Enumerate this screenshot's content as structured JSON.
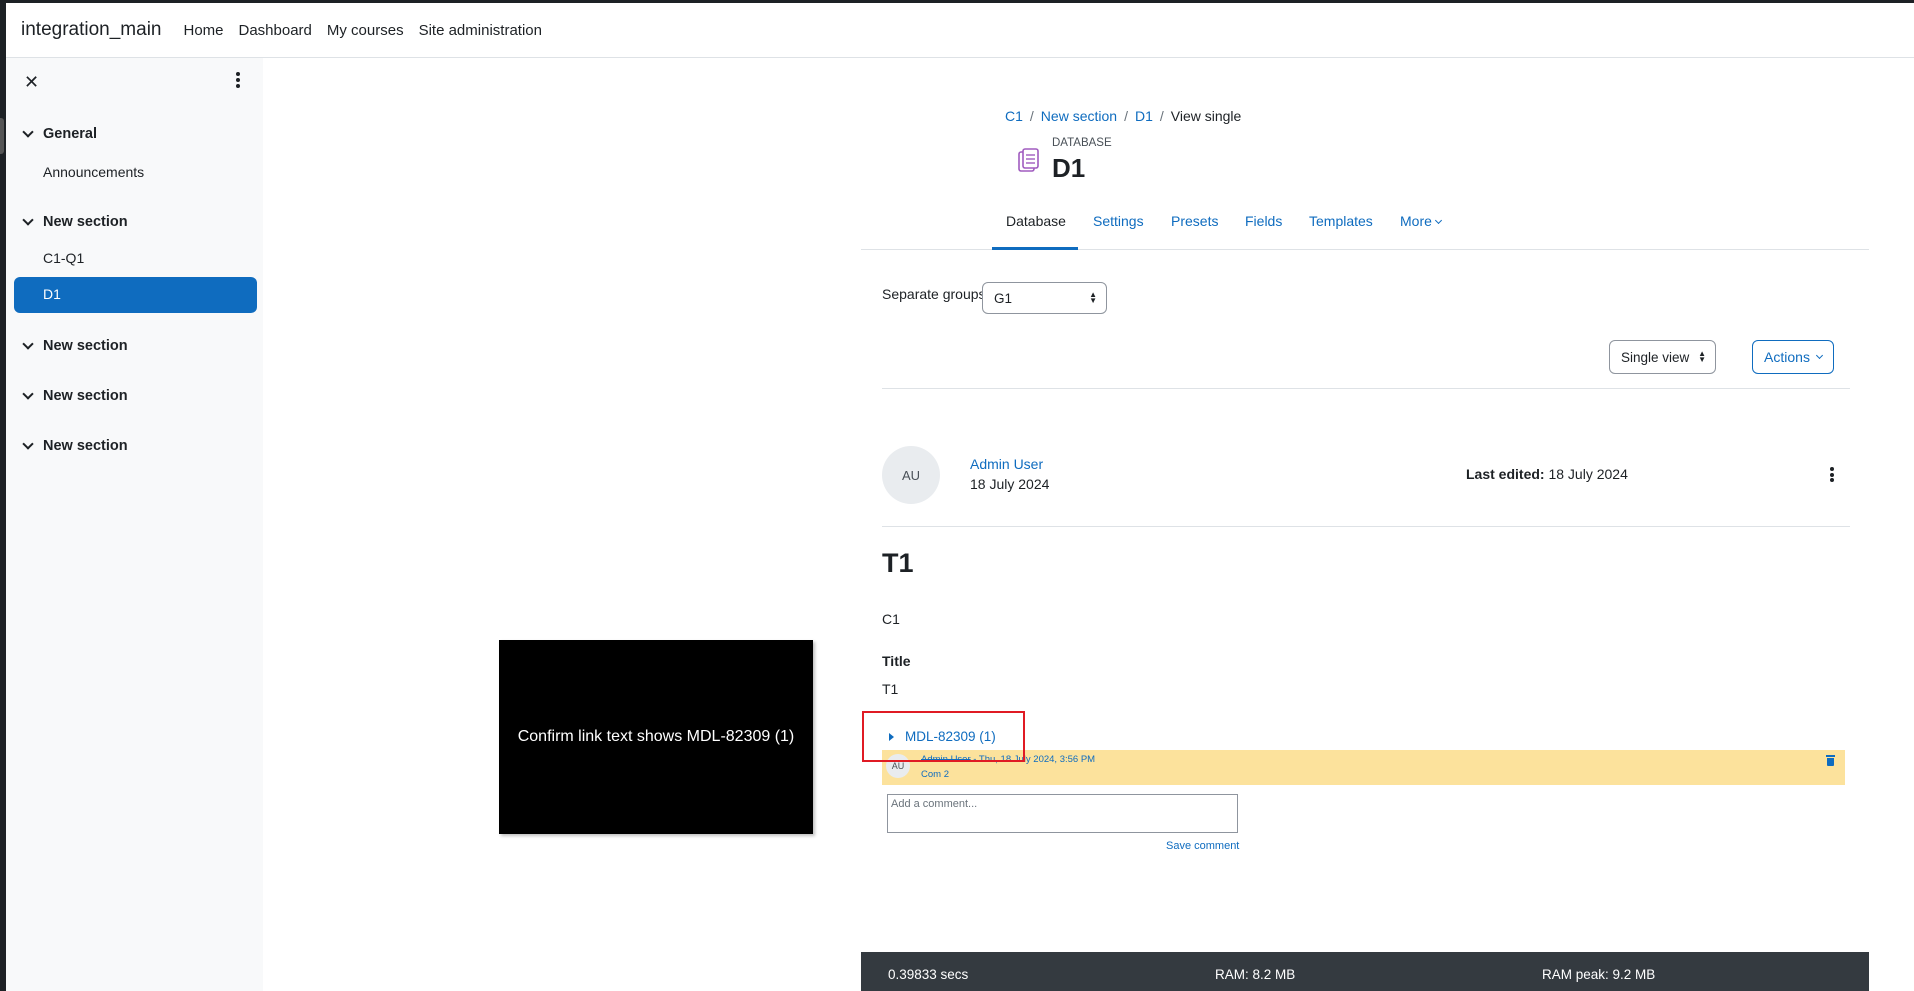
{
  "navbar": {
    "brand": "integration_main",
    "links": [
      "Home",
      "Dashboard",
      "My courses",
      "Site administration"
    ]
  },
  "drawer": {
    "sections": [
      {
        "title": "General",
        "items": [
          "Announcements"
        ]
      },
      {
        "title": "New section",
        "items": [
          "C1-Q1",
          "D1"
        ],
        "active_item": "D1"
      },
      {
        "title": "New section",
        "items": []
      },
      {
        "title": "New section",
        "items": []
      },
      {
        "title": "New section",
        "items": []
      }
    ]
  },
  "breadcrumb": [
    "C1",
    "New section",
    "D1",
    "View single"
  ],
  "module": {
    "kind": "DATABASE",
    "title": "D1",
    "icon": "database-icon"
  },
  "tabs": [
    "Database",
    "Settings",
    "Presets",
    "Fields",
    "Templates",
    "More"
  ],
  "active_tab": "Database",
  "groups": {
    "label": "Separate groups",
    "selected": "G1"
  },
  "view_select": "Single view",
  "actions_label": "Actions",
  "entry": {
    "avatar_initials": "AU",
    "author": "Admin User",
    "date": "18 July 2024",
    "last_edited_label": "Last edited:",
    "last_edited_value": "18 July 2024",
    "title": "T1",
    "text": "C1",
    "field_label": "Title",
    "field_value": "T1"
  },
  "comments": {
    "toggle_label": "MDL-82309 (1)",
    "items": [
      {
        "avatar": "AU",
        "author": "Admin User",
        "timestamp": "Thu, 18 July 2024, 3:56 PM",
        "text": "Com 2"
      }
    ],
    "input_placeholder": "Add a comment...",
    "save_label": "Save comment"
  },
  "overlay_text": "Confirm link text shows MDL-82309 (1)",
  "footer": {
    "time": "0.39833 secs",
    "ram": "RAM: 8.2 MB",
    "ram_peak": "RAM peak: 9.2 MB"
  },
  "colors": {
    "primary": "#0f6cbf",
    "highlight": "#e01b24",
    "comment_bg": "#fce29c",
    "footer_bg": "#343a40"
  }
}
